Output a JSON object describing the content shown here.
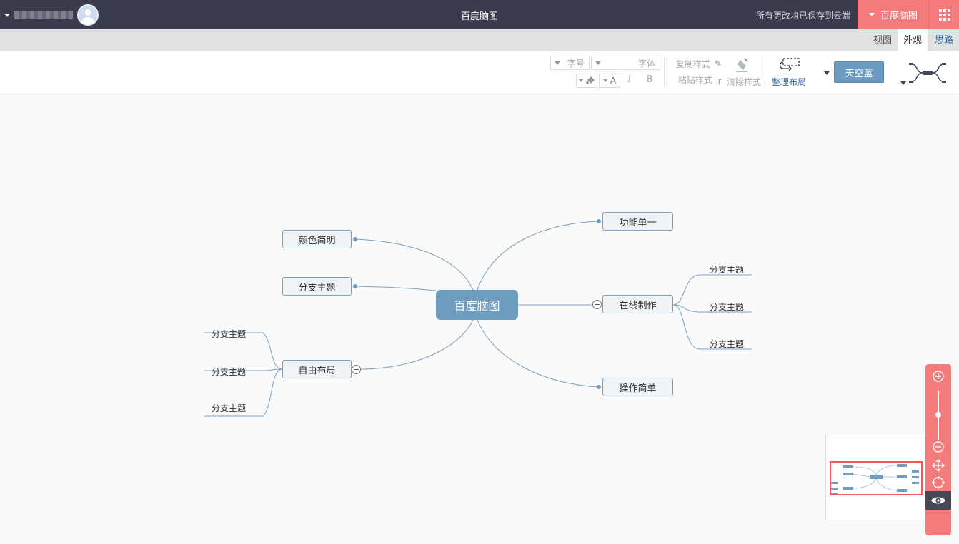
{
  "topbar": {
    "title": "百度脑图",
    "save_status": "所有更改均已保存到云端",
    "app_menu_label": "百度脑图",
    "apps_icon": "grid-icon",
    "avatar_icon": "user-avatar"
  },
  "tabs": [
    {
      "label": "思路"
    },
    {
      "label": "外观"
    },
    {
      "label": "视图"
    }
  ],
  "active_tab": "外观",
  "toolbar": {
    "structure_icon": "mindmap-structure-icon",
    "theme_label": "天空蓝",
    "layout_label": "整理布局",
    "clear_style_label": "清除样式",
    "copy_style_label": "复制样式",
    "paste_style_label": "粘贴样式",
    "font_placeholder": "字体",
    "size_placeholder": "字号",
    "bold_label": "B",
    "italic_label": "I",
    "font_color_label": "A"
  },
  "mindmap": {
    "root": "百度脑图",
    "right_nodes": [
      {
        "label": "功能单一"
      },
      {
        "label": "在线制作",
        "children": [
          "分支主题",
          "分支主题",
          "分支主题"
        ]
      },
      {
        "label": "操作简单"
      }
    ],
    "left_nodes": [
      {
        "label": "颜色简明"
      },
      {
        "label": "分支主题"
      },
      {
        "label": "自由布局",
        "children": [
          "分支主题",
          "分支主题",
          "分支主题"
        ]
      }
    ]
  },
  "colors": {
    "topbar_bg": "#383c4c",
    "accent_red": "#f47b7b",
    "root_node": "#6f9dc0",
    "edge": "#7a9fc0"
  },
  "navigator": {
    "zoom_in_icon": "zoom-in-icon",
    "zoom_out_icon": "zoom-out-icon",
    "move_icon": "move-icon",
    "locate_icon": "locate-icon",
    "preview_icon": "eye-icon"
  }
}
